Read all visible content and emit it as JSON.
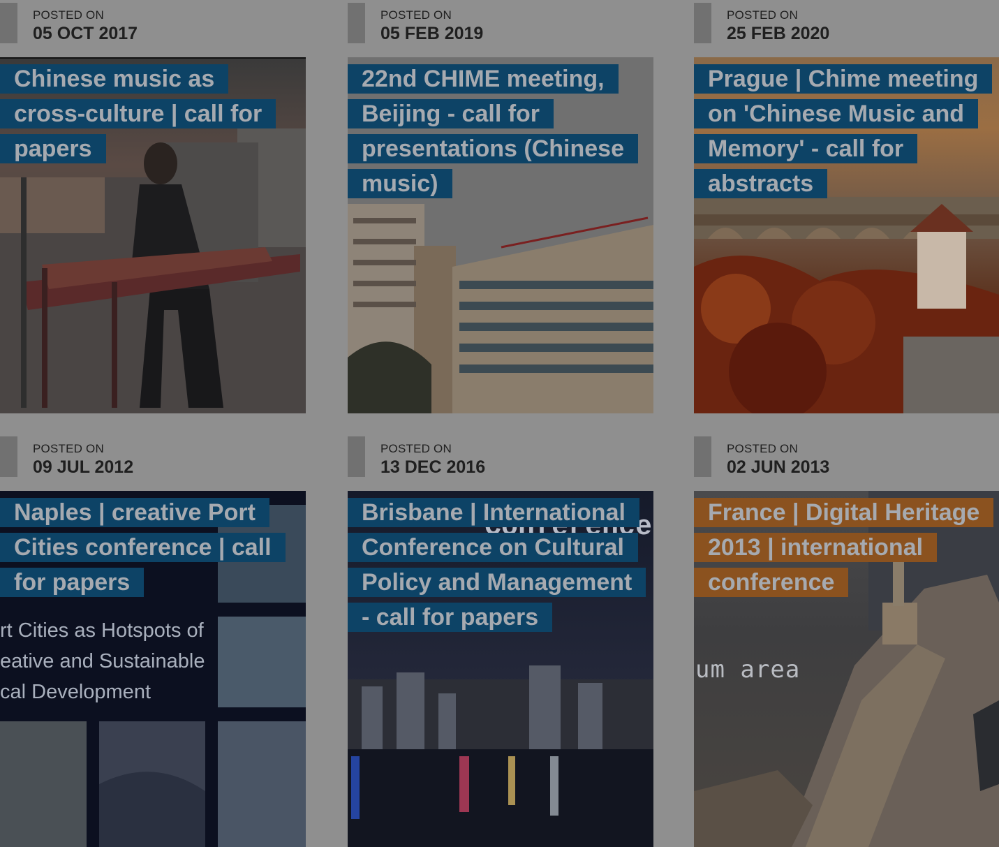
{
  "posts": [
    {
      "posted_label": "POSTED ON",
      "date": "05 OCT 2017",
      "title": "Chinese music as cross-culture | call for papers",
      "image": "guzheng-performer"
    },
    {
      "posted_label": "POSTED ON",
      "date": "05 FEB 2019",
      "title": "22nd CHIME meeting, Beijing - call for presentations (Chinese music)",
      "image": "central-conservatory-building"
    },
    {
      "posted_label": "POSTED ON",
      "date": "25 FEB 2020",
      "title": "Prague | Chime meeting on 'Chinese Music and Memory' - call for abstracts",
      "image": "prague-autumn-bridge"
    },
    {
      "posted_label": "POSTED ON",
      "date": "09 JUL 2012",
      "title": "Naples | creative Port Cities conference | call for papers",
      "image": "port-cities-collage",
      "image_text": [
        "rt Cities as Hotspots of",
        "eative and Sustainable",
        "cal Development"
      ]
    },
    {
      "posted_label": "POSTED ON",
      "date": "13 DEC 2016",
      "title": "Brisbane | International Conference on Cultural Policy and Management - call for papers",
      "image": "brisbane-night-river",
      "image_text": [
        "Conference"
      ]
    },
    {
      "posted_label": "POSTED ON",
      "date": "02 JUN 2013",
      "title": "France | Digital Heritage 2013 | international conference",
      "image": "marseille-aerial",
      "image_text": [
        "um area"
      ],
      "title_color": "#8b521f"
    }
  ],
  "colors": {
    "overlay": "#8f8f8f",
    "title_bg": "#0d4366",
    "title_bg_alt": "#8b521f",
    "title_text": "#a6aab0",
    "date_text": "#1f1f1f"
  }
}
